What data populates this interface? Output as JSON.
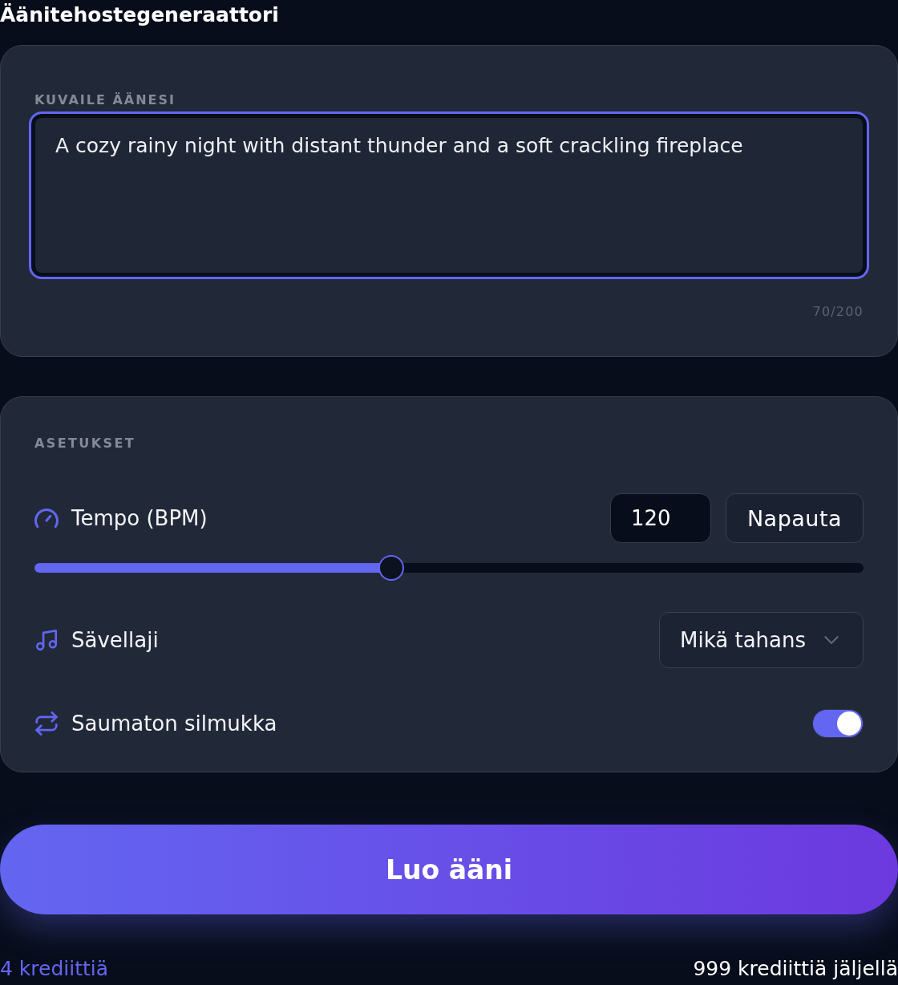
{
  "title": "Äänitehostegeneraattori",
  "prompt": {
    "label": "KUVAILE ÄÄNESI",
    "value": "A cozy rainy night with distant thunder and a soft crackling fireplace",
    "focused": true,
    "counter": "70/200"
  },
  "settings": {
    "heading": "ASETUKSET",
    "rows": [
      {
        "kind": "slider",
        "label": "Tempo (BPM)",
        "value": "120",
        "button": "Napauta",
        "level": 0.43
      },
      {
        "kind": "select",
        "label": "Sävellaji",
        "value": "Mikä tahans"
      },
      {
        "kind": "toggle",
        "label": "Saumaton silmukka",
        "on": true
      }
    ]
  },
  "generate_button": "Luo ääni",
  "footer": {
    "cost": "4 krediittiä",
    "balance": "999 krediittiä jäljellä"
  }
}
